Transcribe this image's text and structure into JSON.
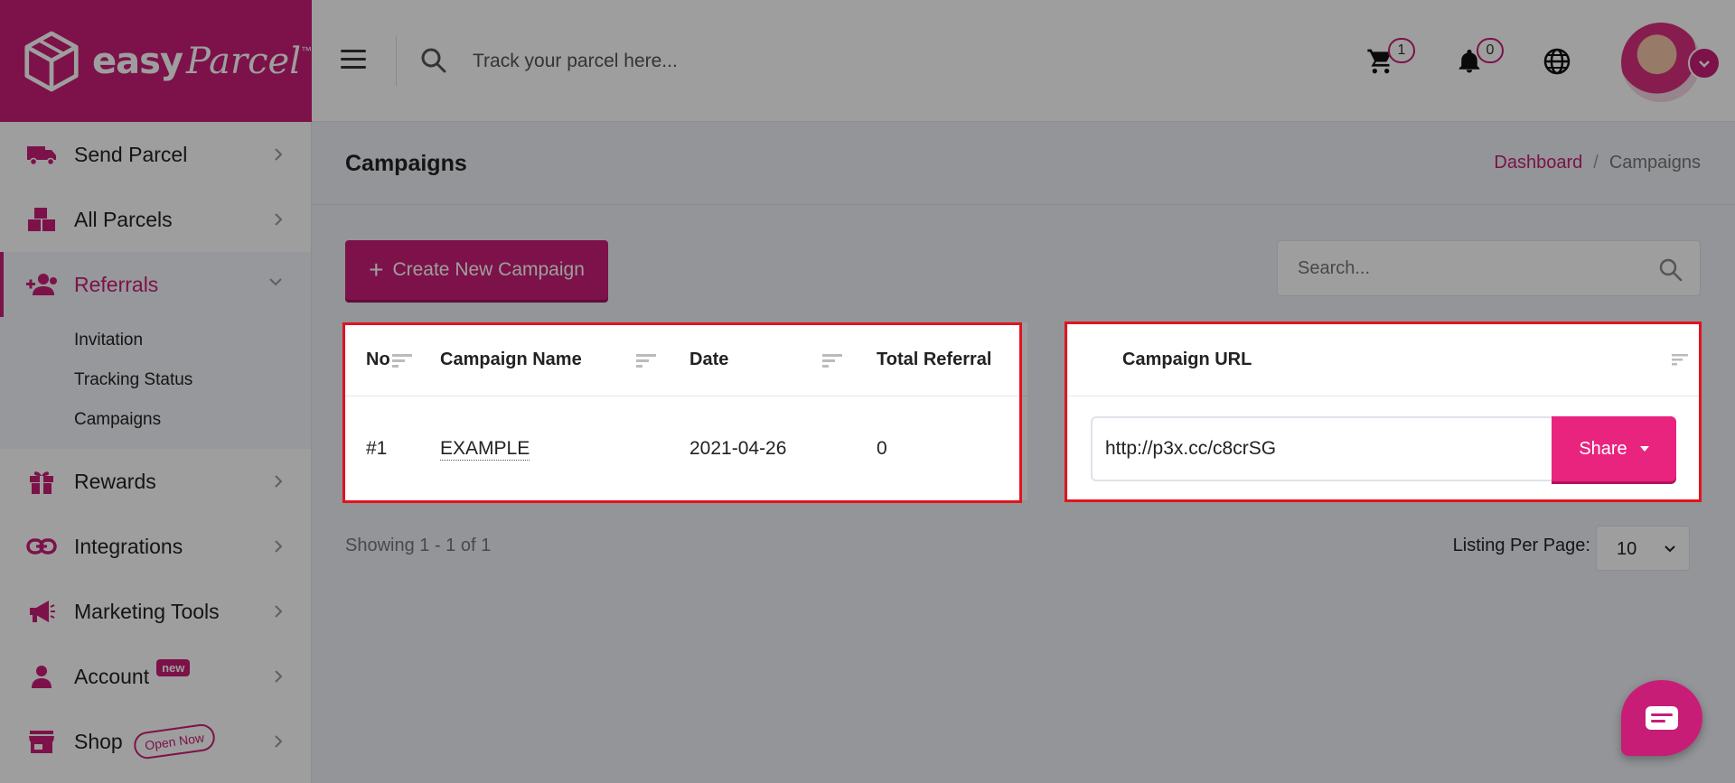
{
  "brand": {
    "easy": "easy",
    "parcel": "Parcel",
    "tm": "™"
  },
  "header": {
    "search_placeholder": "Track your parcel here...",
    "cart_count": "1",
    "notification_count": "0"
  },
  "sidebar": {
    "items": [
      {
        "label": "Send Parcel",
        "icon": "truck-icon"
      },
      {
        "label": "All Parcels",
        "icon": "boxes-icon"
      },
      {
        "label": "Referrals",
        "icon": "user-add-icon",
        "active": true
      },
      {
        "label": "Rewards",
        "icon": "gift-icon"
      },
      {
        "label": "Integrations",
        "icon": "link-icon"
      },
      {
        "label": "Marketing Tools",
        "icon": "megaphone-icon"
      },
      {
        "label": "Account",
        "icon": "person-icon",
        "badge": "new"
      },
      {
        "label": "Shop",
        "icon": "store-icon",
        "badge": "Open Now"
      }
    ],
    "referrals_sub": [
      "Invitation",
      "Tracking Status",
      "Campaigns"
    ]
  },
  "page": {
    "title": "Campaigns",
    "breadcrumb": {
      "home": "Dashboard",
      "sep": "/",
      "current": "Campaigns"
    },
    "create_button": "Create New Campaign",
    "create_plus": "+",
    "search_placeholder": "Search..."
  },
  "table": {
    "headers": {
      "no": "No",
      "name": "Campaign Name",
      "date": "Date",
      "total": "Total Referral",
      "url": "Campaign URL"
    },
    "rows": [
      {
        "no": "#1",
        "name": "EXAMPLE",
        "date": "2021-04-26",
        "total": "0",
        "url": "http://p3x.cc/c8crSG"
      }
    ],
    "share_label": "Share"
  },
  "footer": {
    "showing": "Showing 1 - 1 of 1",
    "listing_label": "Listing Per Page:",
    "listing_value": "10"
  },
  "colors": {
    "brand": "#c81d77",
    "share": "#e8247f",
    "highlight": "#e0141e"
  }
}
